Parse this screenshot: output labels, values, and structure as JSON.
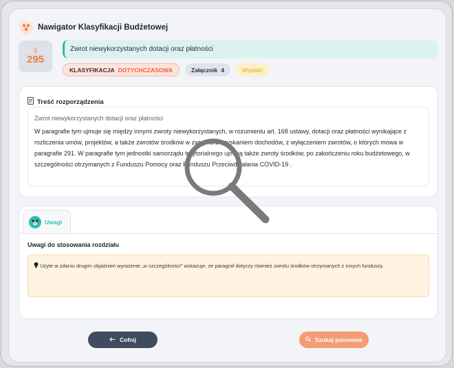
{
  "app": {
    "title": "Nawigator Klasyfikacji Budżetowej"
  },
  "paragraph": {
    "symbol": "§",
    "number": "295"
  },
  "title_bar": {
    "text": "Zwrot niewykorzystanych dotacji oraz płatności"
  },
  "badges": {
    "classification_label": "KLASYFIKACJA",
    "classification_value": "DOTYCHCZASOWA",
    "attachment_label": "Załącznik",
    "attachment_value": "4",
    "expenses": "Wydatki"
  },
  "regulation": {
    "section_title": "Treść rozporządzenia",
    "subtitle": "Zwrot niewykorzystanych dotacji oraz płatności",
    "body": "W  paragrafie tym ujmuje się między innymi zwroty niewykorzystanych, w  rozumieniu art. 168 ustawy, dotacji oraz płatności wynikające z rozliczenia umów, projektów, a także zwrotów środków w związku z uzyskaniem dochodów, z wyłączeniem zwrotów, o których mowa w paragrafie 291. W paragrafie tym jednostki samorządu terytorialnego ujmują także zwroty środków, po zakończeniu roku budżetowego, w szczególności otrzymanych z Funduszu Pomocy oraz Funduszu Przeciwdziałania COVID-19 ."
  },
  "notes": {
    "tab_label": "Uwagi",
    "title": "Uwagi do stosowania rozdziału",
    "text": "Użyte w zdaniu drugim objaśnień wyrażenie „w szczególności\" wskazuje, że paragraf dotyczy również zwrotu środków otrzymanych z innych funduszy."
  },
  "buttons": {
    "back": "Cofnij",
    "search_again": "Szukaj ponownie"
  },
  "colors": {
    "accent_orange": "#f07a45",
    "accent_teal": "#27b9a6",
    "button_dark": "#3f4b5e",
    "button_orange": "#f59b75"
  },
  "icons": {
    "logo": "share-nodes-icon",
    "document": "document-icon",
    "notes_tab": "paw-icon",
    "bulb": "lightbulb-icon",
    "back": "arrow-left-icon",
    "search": "search-icon",
    "overlay": "magnifier-icon"
  }
}
